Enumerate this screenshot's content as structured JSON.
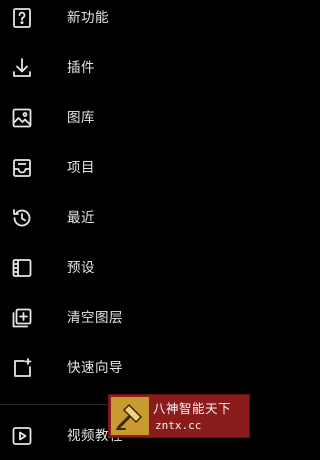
{
  "menu": {
    "items": [
      {
        "label": "新功能",
        "icon": "new-features-icon"
      },
      {
        "label": "插件",
        "icon": "download-icon"
      },
      {
        "label": "图库",
        "icon": "image-icon"
      },
      {
        "label": "项目",
        "icon": "inbox-icon"
      },
      {
        "label": "最近",
        "icon": "history-icon"
      },
      {
        "label": "预设",
        "icon": "film-icon"
      },
      {
        "label": "清空图层",
        "icon": "add-box-icon"
      },
      {
        "label": "快速向导",
        "icon": "quick-guide-icon"
      },
      {
        "label": "视频教程",
        "icon": "play-icon"
      }
    ]
  },
  "watermark": {
    "title": "八神智能天下",
    "url": "zntx.cc"
  },
  "colors": {
    "background": "#000000",
    "text": "#e6e6e6",
    "watermark_bg": "#8a1c1c"
  }
}
